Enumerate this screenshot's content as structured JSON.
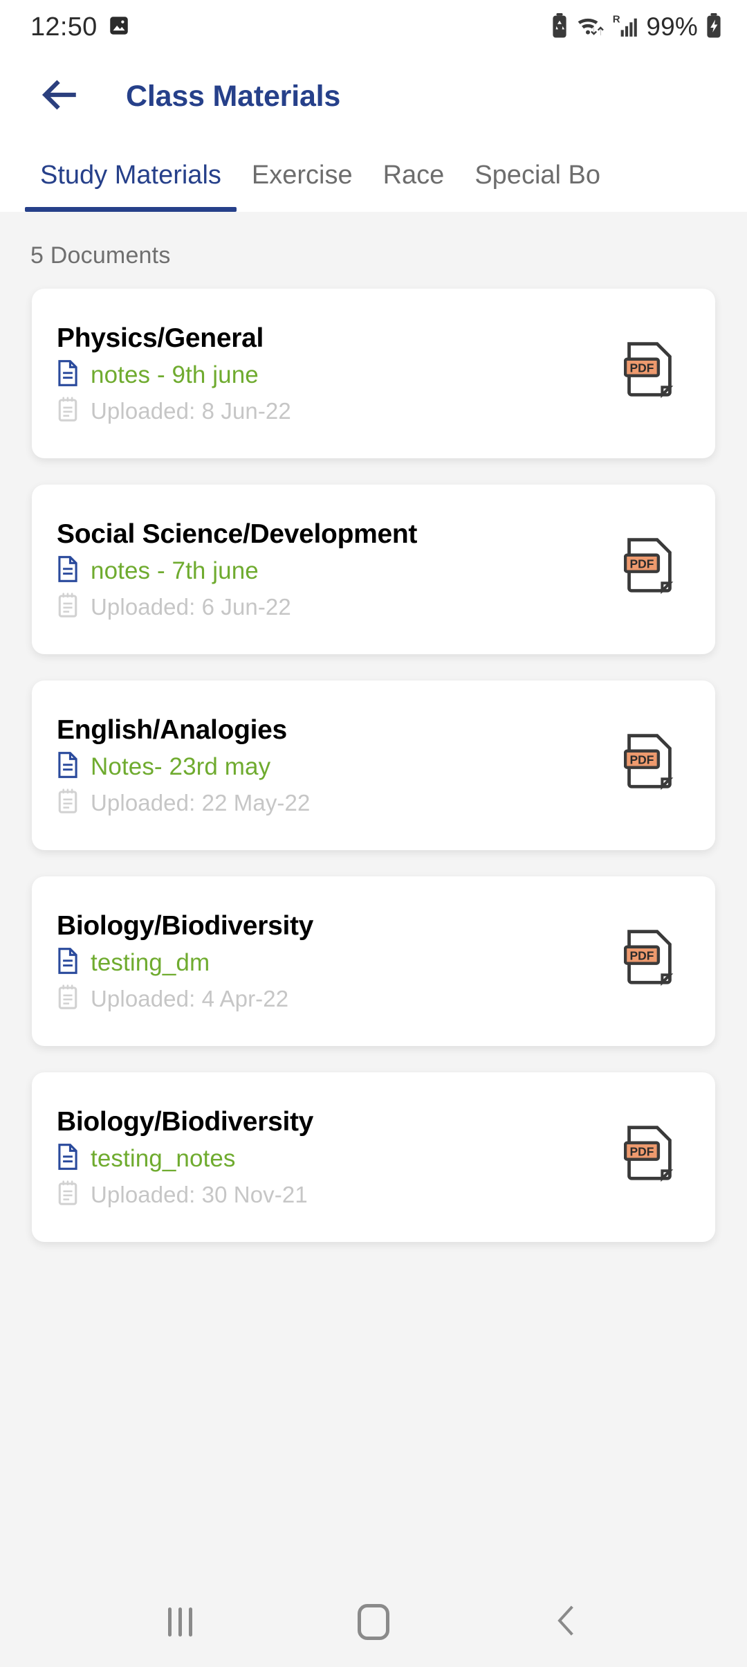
{
  "status_bar": {
    "time": "12:50",
    "battery_percent": "99%",
    "icons": [
      "image-icon",
      "battery-saver-icon",
      "wifi-icon",
      "roaming-signal-icon",
      "charging-battery-icon"
    ]
  },
  "app_bar": {
    "back_icon": "back-arrow-icon",
    "title": "Class Materials",
    "title_color": "#26408a"
  },
  "tabs": {
    "active_index": 0,
    "items": [
      {
        "label": "Study Materials"
      },
      {
        "label": "Exercise"
      },
      {
        "label": "Race"
      },
      {
        "label": "Special Bo"
      }
    ]
  },
  "main": {
    "count_label": "5 Documents",
    "accent_green": "#6fab2f",
    "documents": [
      {
        "title": "Physics/General",
        "file_name": "notes - 9th june",
        "uploaded": "Uploaded: 8 Jun-22",
        "file_type": "PDF"
      },
      {
        "title": "Social Science/Development",
        "file_name": "notes - 7th june",
        "uploaded": "Uploaded: 6 Jun-22",
        "file_type": "PDF"
      },
      {
        "title": "English/Analogies",
        "file_name": "Notes- 23rd may",
        "uploaded": "Uploaded: 22 May-22",
        "file_type": "PDF"
      },
      {
        "title": "Biology/Biodiversity",
        "file_name": "testing_dm",
        "uploaded": "Uploaded: 4 Apr-22",
        "file_type": "PDF"
      },
      {
        "title": "Biology/Biodiversity",
        "file_name": "testing_notes",
        "uploaded": "Uploaded: 30 Nov-21",
        "file_type": "PDF"
      }
    ]
  },
  "nav_bar": {
    "recents_icon": "recents-icon",
    "home_icon": "home-icon",
    "back_icon": "back-chevron-icon"
  }
}
